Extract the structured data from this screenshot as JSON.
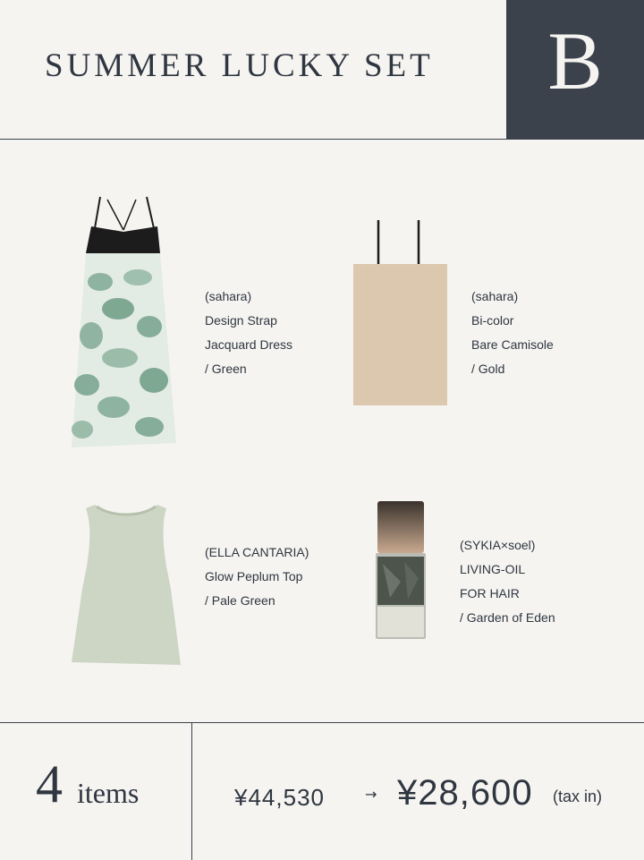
{
  "header": {
    "title": "SUMMER LUCKY SET",
    "set_letter": "B"
  },
  "products": [
    {
      "brand": "(sahara)",
      "name_line1": "Design Strap",
      "name_line2": "Jacquard Dress",
      "color": "/ Green",
      "icon": "dress-image"
    },
    {
      "brand": "(sahara)",
      "name_line1": "Bi-color",
      "name_line2": "Bare Camisole",
      "color": "/ Gold",
      "icon": "camisole-image"
    },
    {
      "brand": "(ELLA CANTARIA)",
      "name_line1": "Glow Peplum Top",
      "color": "/ Pale Green",
      "icon": "peplum-top-image"
    },
    {
      "brand": "(SYKIA×soel)",
      "name_line1": "LIVING-OIL",
      "name_line2": "FOR HAIR",
      "color": "/ Garden of Eden",
      "icon": "hair-oil-bottle-image"
    }
  ],
  "footer": {
    "count": "4",
    "count_label": "items",
    "price_original": "¥44,530",
    "arrow": "→",
    "price_sale": "¥28,600",
    "tax_note": "(tax in)"
  },
  "colors": {
    "background": "#f5f4f1",
    "accent_dark": "#3c424c",
    "text": "#2f3640"
  }
}
